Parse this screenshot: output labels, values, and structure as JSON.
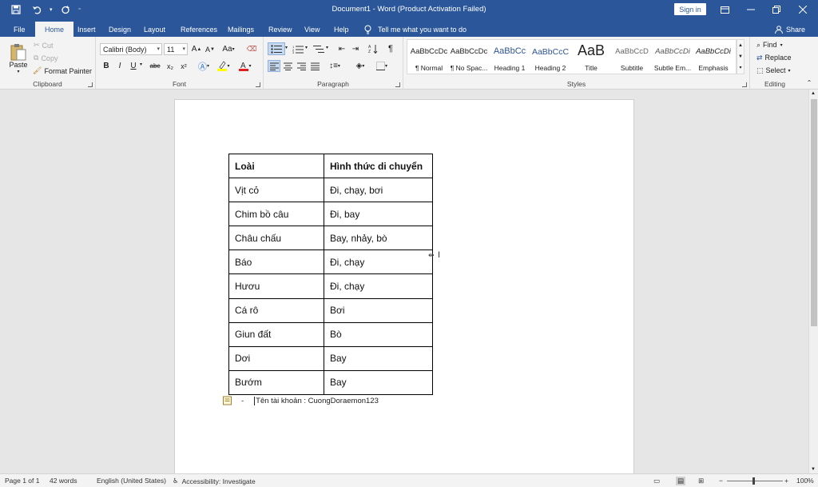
{
  "window": {
    "title": "Document1  -  Word (Product Activation Failed)",
    "sign_in": "Sign in"
  },
  "tabs": [
    {
      "label": "File"
    },
    {
      "label": "Home"
    },
    {
      "label": "Insert"
    },
    {
      "label": "Design"
    },
    {
      "label": "Layout"
    },
    {
      "label": "References"
    },
    {
      "label": "Mailings"
    },
    {
      "label": "Review"
    },
    {
      "label": "View"
    },
    {
      "label": "Help"
    }
  ],
  "tell_me": "Tell me what you want to do",
  "share": "Share",
  "ribbon": {
    "clipboard": {
      "label": "Clipboard",
      "paste": "Paste",
      "cut": "Cut",
      "copy": "Copy",
      "format_painter": "Format Painter"
    },
    "font": {
      "label": "Font",
      "font_name": "Calibri (Body)",
      "font_size": "11",
      "grow": "A",
      "shrink": "A",
      "change_case": "Aa",
      "bold": "B",
      "italic": "I",
      "underline": "U",
      "strikethrough": "abc",
      "subscript": "x₂",
      "superscript": "x²"
    },
    "paragraph": {
      "label": "Paragraph",
      "pilcrow": "¶"
    },
    "styles": {
      "label": "Styles",
      "items": [
        {
          "sample": "AaBbCcDc",
          "name": "¶ Normal"
        },
        {
          "sample": "AaBbCcDc",
          "name": "¶ No Spac..."
        },
        {
          "sample": "AaBbCc",
          "name": "Heading 1"
        },
        {
          "sample": "AaBbCcC",
          "name": "Heading 2"
        },
        {
          "sample": "AaB",
          "name": "Title"
        },
        {
          "sample": "AaBbCcD",
          "name": "Subtitle"
        },
        {
          "sample": "AaBbCcDi",
          "name": "Subtle Em..."
        },
        {
          "sample": "AaBbCcDi",
          "name": "Emphasis"
        }
      ]
    },
    "editing": {
      "label": "Editing",
      "find": "Find",
      "replace": "Replace",
      "select": "Select"
    }
  },
  "table": {
    "header": [
      "Loài",
      "Hình thức di chuyển"
    ],
    "rows": [
      [
        "Vịt cỏ",
        "Đi, chạy, bơi"
      ],
      [
        "Chim bồ câu",
        "Đi, bay"
      ],
      [
        "Châu chấu",
        "Bay, nhảy, bò"
      ],
      [
        "Báo",
        "Đi, chạy"
      ],
      [
        "Hươu",
        "Đi, chạy"
      ],
      [
        "Cá rô",
        "Bơi"
      ],
      [
        "Giun đất",
        "Bò"
      ],
      [
        "Dơi",
        "Bay"
      ],
      [
        "Bướm",
        "Bay"
      ]
    ]
  },
  "bullet_line": {
    "marker": "-",
    "text": "Tên tài khoản : CuongDoraemon123"
  },
  "status": {
    "page": "Page 1 of 1",
    "words": "42 words",
    "language": "English (United States)",
    "accessibility": "Accessibility: Investigate",
    "zoom": "100%"
  },
  "colors": {
    "brand": "#2b579a",
    "ribbon_bg": "#f3f3f3",
    "canvas_bg": "#e6e6e6"
  }
}
